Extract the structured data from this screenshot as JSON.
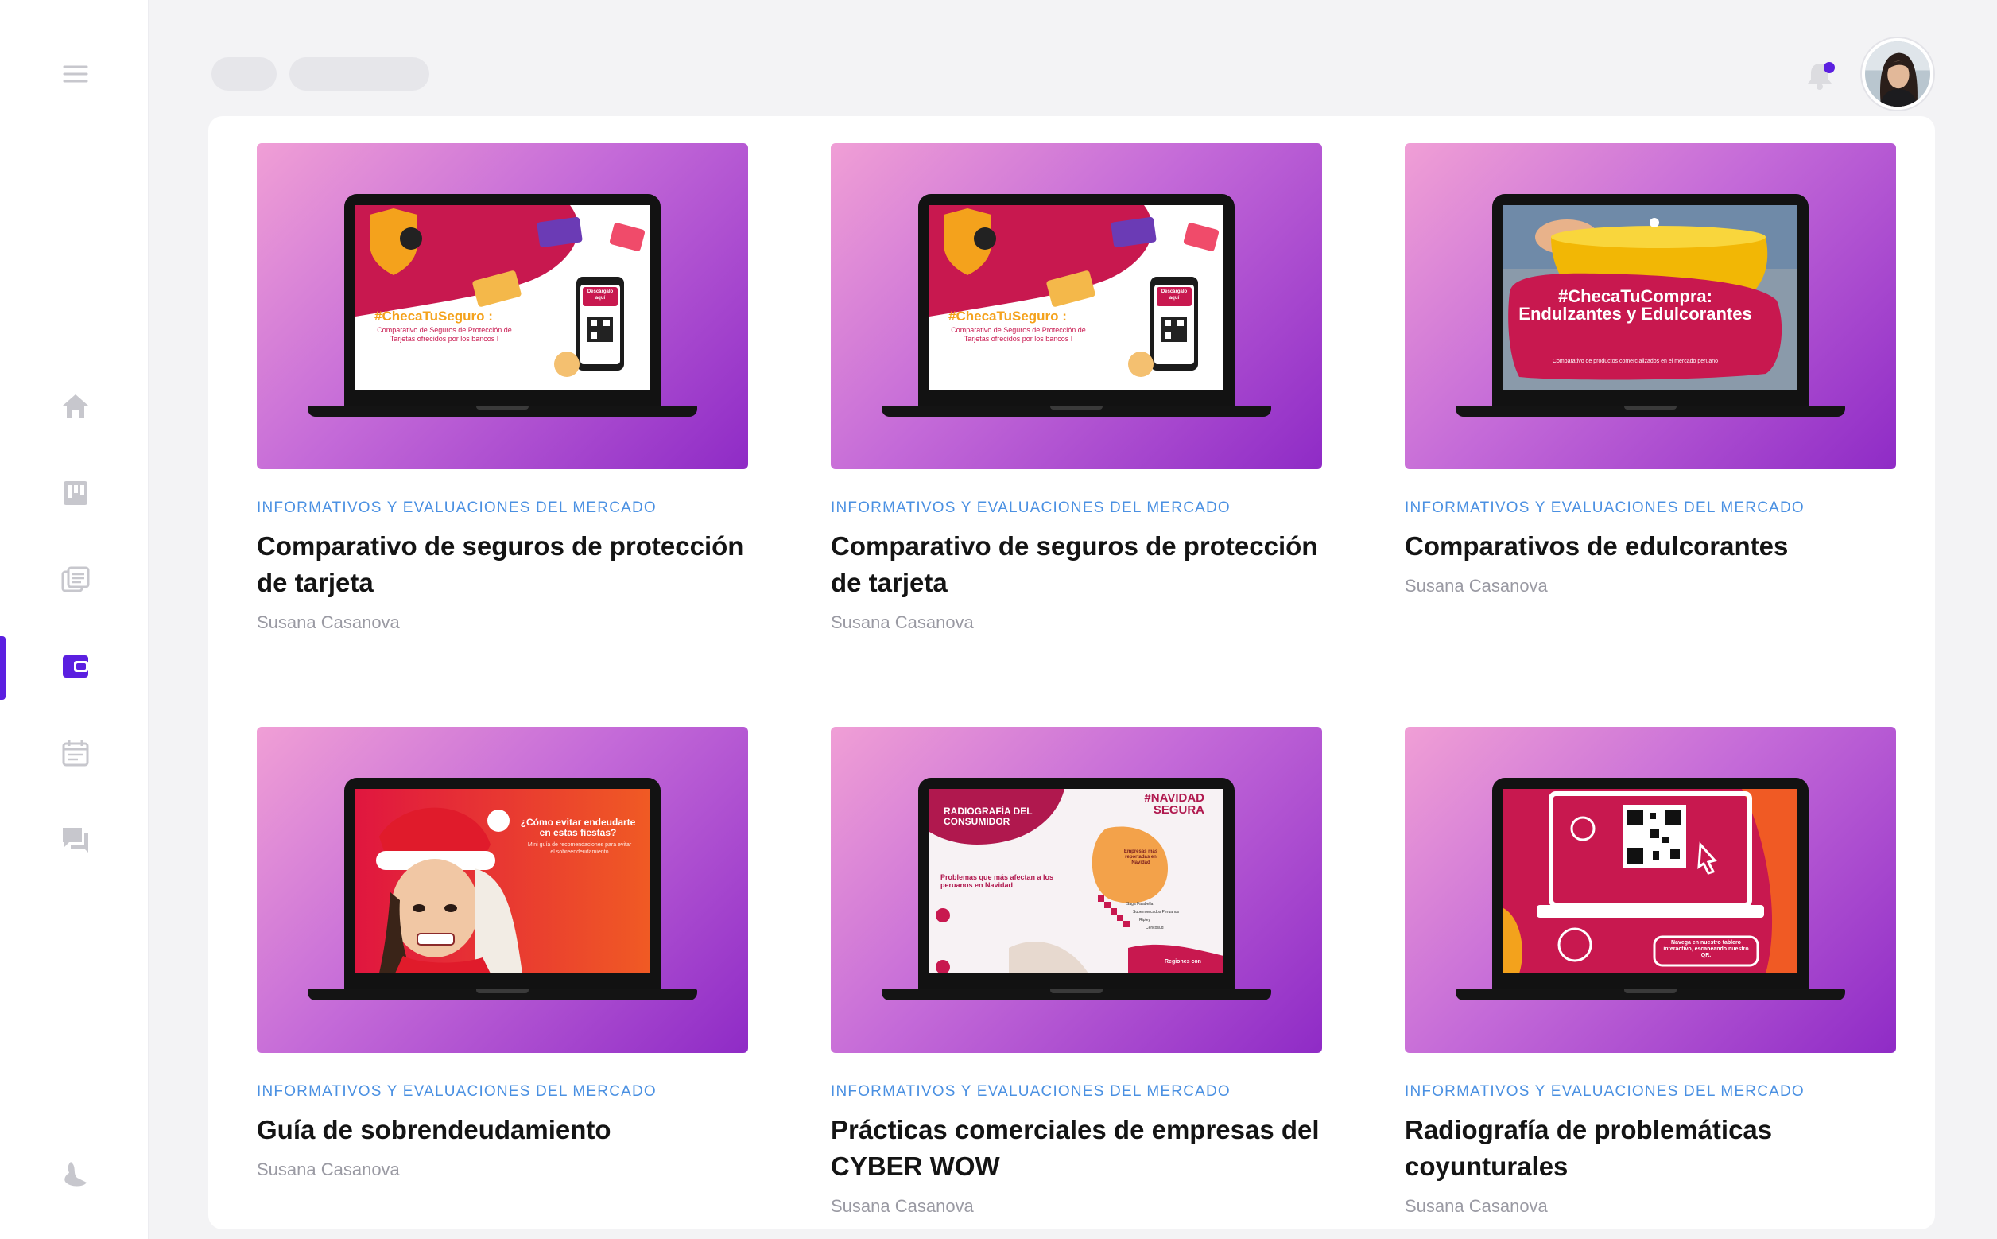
{
  "colors": {
    "accent": "#5b1fe0",
    "category_text": "#4a90e2",
    "notification_dot": "#5b1fe0",
    "sidebar_icon": "#c7c7cd",
    "thumb_gradient": [
      "#f09fd6",
      "#c46ad8",
      "#8f2bc6"
    ]
  },
  "sidebar": {
    "menu_icon": "hamburger-menu-icon",
    "items": [
      {
        "id": "home",
        "icon": "home-icon",
        "active": false
      },
      {
        "id": "boards",
        "icon": "kanban-icon",
        "active": false
      },
      {
        "id": "library",
        "icon": "library-icon",
        "active": false
      },
      {
        "id": "wallet",
        "icon": "wallet-icon",
        "active": true
      },
      {
        "id": "calendar",
        "icon": "calendar-icon",
        "active": false
      },
      {
        "id": "messages",
        "icon": "chat-icon",
        "active": false
      }
    ],
    "bottom_icon": "logo-icon"
  },
  "header": {
    "notification_icon": "bell-icon",
    "has_notification": true,
    "avatar": "user-avatar"
  },
  "cards": [
    {
      "category": "INFORMATIVOS Y EVALUACIONES DEL MERCADO",
      "title": "Comparativo de seguros de protección de tarjeta",
      "author": "Susana Casanova",
      "screen": {
        "headline": "#ChecaTuSeguro :",
        "sub": "Comparativo de Seguros de Protección de Tarjetas ofrecidos por los bancos I",
        "button": "Descárgalo aquí"
      }
    },
    {
      "category": "INFORMATIVOS Y EVALUACIONES DEL MERCADO",
      "title": "Comparativo de seguros de protección de tarjeta",
      "author": "Susana Casanova",
      "screen": {
        "headline": "#ChecaTuSeguro :",
        "sub": "Comparativo de Seguros de Protección de Tarjetas ofrecidos por los bancos I",
        "button": "Descárgalo aquí"
      }
    },
    {
      "category": "INFORMATIVOS Y EVALUACIONES DEL MERCADO",
      "title": "Comparativos de edulcorantes",
      "author": "Susana Casanova",
      "screen": {
        "headline": "#ChecaTuCompra: Endulzantes y Edulcorantes",
        "sub": "Comparativo de productos comercializados en el mercado peruano"
      }
    },
    {
      "category": "INFORMATIVOS Y EVALUACIONES DEL MERCADO",
      "title": "Guía de sobrendeudamiento",
      "author": "Susana Casanova",
      "screen": {
        "headline": "¿Cómo evitar endeudarte en estas fiestas?",
        "sub": "Mini guía de recomendaciones para evitar el sobreendeudamiento"
      }
    },
    {
      "category": "INFORMATIVOS Y EVALUACIONES DEL MERCADO",
      "title": "Prácticas comerciales de empresas del CYBER WOW",
      "author": "Susana Casanova",
      "screen": {
        "headline": "RADIOGRAFÍA DEL CONSUMIDOR",
        "tag": "#NAVIDAD SEGURA",
        "sub": "Problemas que más afectan a los peruanos en Navidad",
        "box": "Empresas más reportadas en Navidad",
        "list": [
          "Saga Falabella",
          "Supermercados Peruanos",
          "Ripley",
          "Cencosud"
        ],
        "footer": "Regiones con"
      }
    },
    {
      "category": "INFORMATIVOS Y EVALUACIONES DEL MERCADO",
      "title": "Radiografía de problemáticas coyunturales",
      "author": "Susana Casanova",
      "screen": {
        "sub": "Navega en nuestro tablero interactivo, escaneando nuestro QR."
      }
    }
  ]
}
